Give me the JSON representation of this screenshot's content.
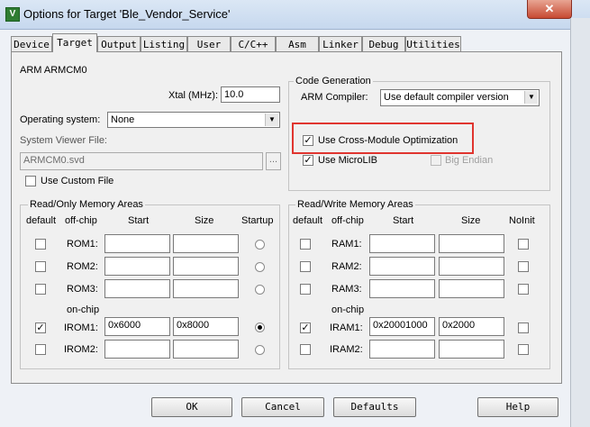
{
  "window": {
    "title": "Options for Target 'Ble_Vendor_Service'",
    "app_icon": "V",
    "close_glyph": "✕"
  },
  "tabs": [
    "Device",
    "Target",
    "Output",
    "Listing",
    "User",
    "C/C++",
    "Asm",
    "Linker",
    "Debug",
    "Utilities"
  ],
  "target": {
    "device_name": "ARM ARMCM0",
    "xtal_label": "Xtal (MHz):",
    "xtal_value": "10.0",
    "os_label": "Operating system:",
    "os_value": "None",
    "svf_label": "System Viewer File:",
    "svf_value": "ARMCM0.svd",
    "browse_label": "...",
    "use_custom_file": "Use Custom File"
  },
  "code_generation": {
    "legend": "Code Generation",
    "compiler_label": "ARM Compiler:",
    "compiler_value": "Use default compiler version",
    "cross_module": "Use Cross-Module Optimization",
    "microlib": "Use MicroLIB",
    "big_endian": "Big Endian"
  },
  "ro_memory": {
    "legend": "Read/Only Memory Areas",
    "headers": {
      "default": "default",
      "offchip": "off-chip",
      "start": "Start",
      "size": "Size",
      "startup": "Startup"
    },
    "onchip_label": "on-chip",
    "rows": [
      {
        "name": "ROM1:",
        "start": "",
        "size": ""
      },
      {
        "name": "ROM2:",
        "start": "",
        "size": ""
      },
      {
        "name": "ROM3:",
        "start": "",
        "size": ""
      },
      {
        "name": "IROM1:",
        "start": "0x6000",
        "size": "0x8000"
      },
      {
        "name": "IROM2:",
        "start": "",
        "size": ""
      }
    ]
  },
  "rw_memory": {
    "legend": "Read/Write Memory Areas",
    "headers": {
      "default": "default",
      "offchip": "off-chip",
      "start": "Start",
      "size": "Size",
      "noinit": "NoInit"
    },
    "onchip_label": "on-chip",
    "rows": [
      {
        "name": "RAM1:",
        "start": "",
        "size": ""
      },
      {
        "name": "RAM2:",
        "start": "",
        "size": ""
      },
      {
        "name": "RAM3:",
        "start": "",
        "size": ""
      },
      {
        "name": "IRAM1:",
        "start": "0x20001000",
        "size": "0x2000"
      },
      {
        "name": "IRAM2:",
        "start": "",
        "size": ""
      }
    ]
  },
  "glyphs": {
    "check": "✓",
    "dropdown": "▼"
  },
  "buttons": {
    "ok": "OK",
    "cancel": "Cancel",
    "defaults": "Defaults",
    "help": "Help"
  }
}
